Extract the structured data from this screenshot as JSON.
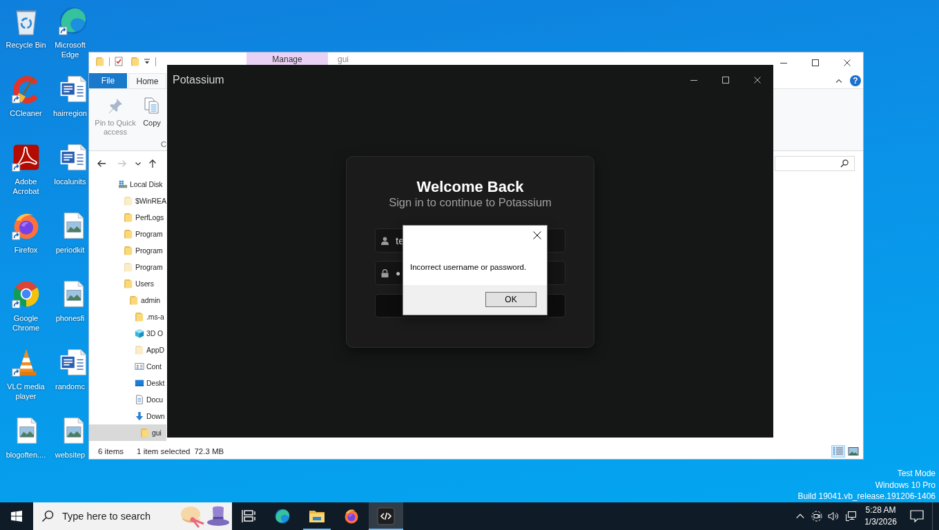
{
  "desktop": {
    "icons": [
      {
        "label": "Recycle Bin",
        "kind": "recycle-bin",
        "shortcut": false
      },
      {
        "label": "CCleaner",
        "kind": "ccleaner",
        "shortcut": true
      },
      {
        "label": "Adobe Acrobat",
        "kind": "acrobat",
        "shortcut": true
      },
      {
        "label": "Firefox",
        "kind": "firefox",
        "shortcut": true
      },
      {
        "label": "Google Chrome",
        "kind": "chrome",
        "shortcut": true
      },
      {
        "label": "VLC media player",
        "kind": "vlc",
        "shortcut": true
      },
      {
        "label": "blogoften....",
        "kind": "image",
        "shortcut": false
      },
      {
        "label": "Microsoft Edge",
        "kind": "edge",
        "shortcut": true
      },
      {
        "label": "hairregion",
        "kind": "word",
        "shortcut": false
      },
      {
        "label": "localunits",
        "kind": "word",
        "shortcut": false
      },
      {
        "label": "periodkit",
        "kind": "image",
        "shortcut": false
      },
      {
        "label": "phonesfi",
        "kind": "image",
        "shortcut": false
      },
      {
        "label": "randomc",
        "kind": "word",
        "shortcut": false
      },
      {
        "label": "websitep",
        "kind": "image",
        "shortcut": false
      }
    ]
  },
  "explorer": {
    "contextual_tab": "Manage",
    "title": "gui",
    "ribbon_tabs": [
      {
        "label": "File",
        "kind": "file",
        "selected": false
      },
      {
        "label": "Home",
        "kind": "tab",
        "selected": true
      }
    ],
    "help_button": "?",
    "ribbon_buttons": [
      {
        "label": "Pin to Quick access",
        "kind": "pin",
        "disabled": true
      },
      {
        "label": "Copy",
        "kind": "copy",
        "disabled": false
      }
    ],
    "ribbon_group_label": "C",
    "navigation_buttons": [
      {
        "kind": "back",
        "disabled": false
      },
      {
        "kind": "forward",
        "disabled": true
      },
      {
        "kind": "recent",
        "disabled": false
      },
      {
        "kind": "up",
        "disabled": false
      }
    ],
    "navigation_tree": [
      {
        "label": "Local Disk",
        "kind": "drive",
        "selected": false,
        "children": [
          {
            "label": "$WinREA",
            "kind": "hidden-folder",
            "selected": false
          },
          {
            "label": "PerfLogs",
            "kind": "folder",
            "selected": false
          },
          {
            "label": "Program",
            "kind": "folder",
            "selected": false
          },
          {
            "label": "Program",
            "kind": "folder",
            "selected": false
          },
          {
            "label": "Program",
            "kind": "hidden-folder",
            "selected": false
          },
          {
            "label": "Users",
            "kind": "folder",
            "selected": false,
            "children": [
              {
                "label": "admin",
                "kind": "folder",
                "selected": false,
                "children": [
                  {
                    "label": ".ms-a",
                    "kind": "folder",
                    "selected": false
                  },
                  {
                    "label": "3D O",
                    "kind": "cube",
                    "selected": false
                  },
                  {
                    "label": "AppD",
                    "kind": "hidden-folder",
                    "selected": false
                  },
                  {
                    "label": "Cont",
                    "kind": "contacts",
                    "selected": false
                  },
                  {
                    "label": "Deskt",
                    "kind": "desktop",
                    "selected": false
                  },
                  {
                    "label": "Docu",
                    "kind": "documents",
                    "selected": false
                  },
                  {
                    "label": "Down",
                    "kind": "downloads",
                    "selected": false,
                    "children": [
                      {
                        "label": "gui",
                        "kind": "folder",
                        "selected": true
                      }
                    ]
                  }
                ]
              }
            ]
          }
        ]
      }
    ],
    "status_bar": {
      "item_count": "6 items",
      "selection": "1 item selected",
      "size": "72.3 MB"
    },
    "view_buttons": [
      {
        "kind": "details",
        "selected": true
      },
      {
        "kind": "large-icons",
        "selected": false
      }
    ]
  },
  "potassium": {
    "title": "Potassium",
    "heading": "Welcome Back",
    "subheading": "Sign in to continue to Potassium",
    "username": {
      "value": "te"
    },
    "password": {
      "value": "●"
    }
  },
  "message_box": {
    "message": "Incorrect username or password.",
    "button": "OK"
  },
  "system_notice": [
    "Test Mode",
    "Windows 10 Pro",
    "Build 19041.vb_release.191206-1406"
  ],
  "taskbar": {
    "search": {
      "placeholder": "Type here to search"
    },
    "items": [
      {
        "kind": "task-view",
        "running": false,
        "active": false
      },
      {
        "kind": "edge",
        "running": false,
        "active": false
      },
      {
        "kind": "explorer",
        "running": true,
        "active": false
      },
      {
        "kind": "firefox",
        "running": false,
        "active": false
      },
      {
        "kind": "potassium",
        "running": true,
        "active": true
      }
    ],
    "clock": {
      "time": "5:28 AM",
      "date": "1/3/2026"
    }
  }
}
